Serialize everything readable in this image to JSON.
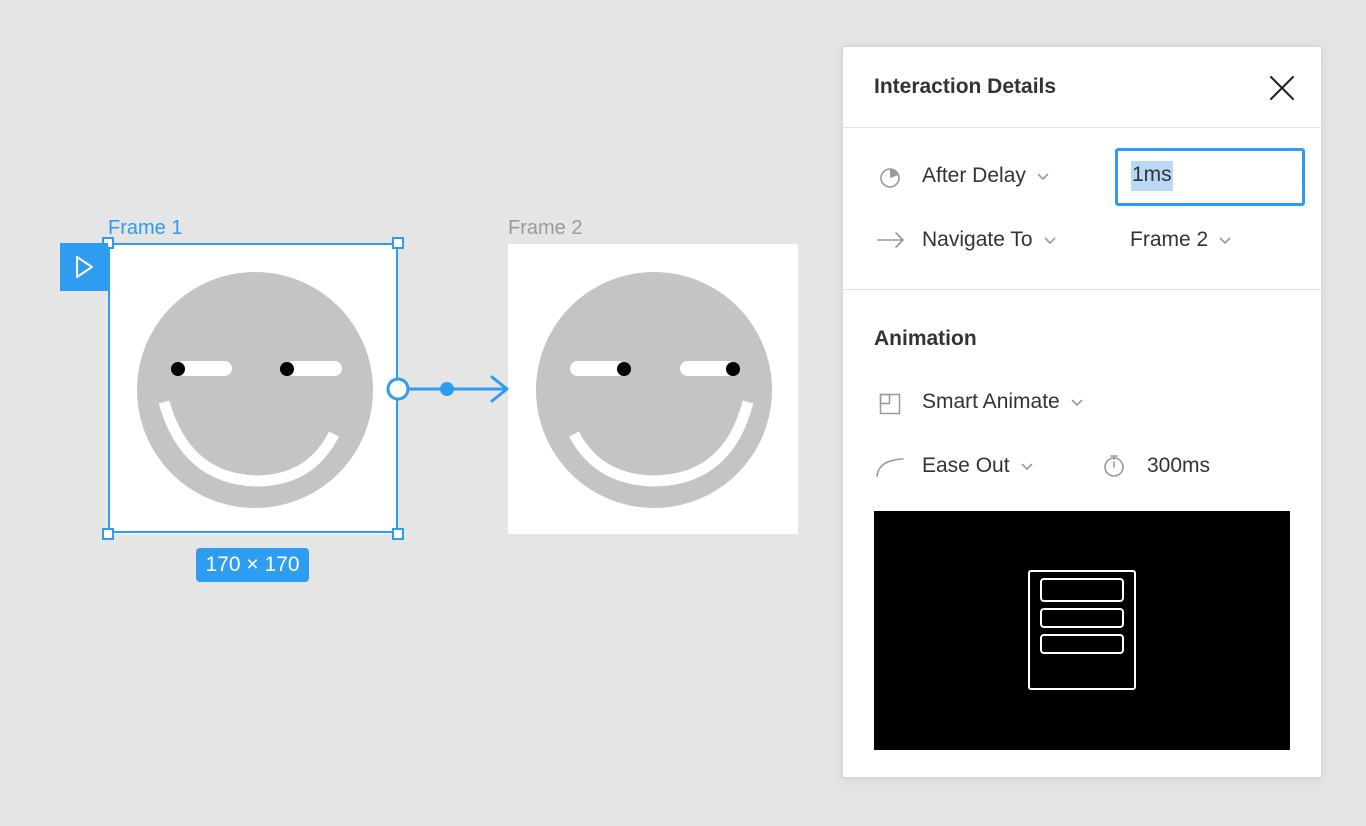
{
  "canvas": {
    "frame1": {
      "label": "Frame 1",
      "size_badge": "170 × 170"
    },
    "frame2": {
      "label": "Frame 2"
    }
  },
  "panel": {
    "title": "Interaction Details",
    "trigger": {
      "label": "After Delay",
      "icon": "timer-icon"
    },
    "delay": {
      "value": "1ms"
    },
    "action": {
      "label": "Navigate To",
      "icon": "arrow-right-icon"
    },
    "destination": {
      "label": "Frame 2"
    },
    "animation_section": {
      "title": "Animation"
    },
    "animation": {
      "label": "Smart Animate",
      "icon": "smart-animate-icon"
    },
    "easing": {
      "label": "Ease Out",
      "icon": "ease-curve-icon"
    },
    "duration": {
      "value": "300ms",
      "icon": "stopwatch-icon"
    }
  },
  "colors": {
    "accent": "#2e9cf0",
    "canvas_bg": "#e5e5e5",
    "face": "#c4c4c4"
  }
}
